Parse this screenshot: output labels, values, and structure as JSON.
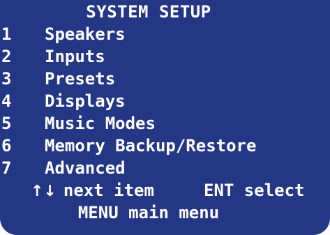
{
  "screen": {
    "title": "SYSTEM SETUP",
    "menu_items": [
      {
        "number": "1",
        "label": "Speakers"
      },
      {
        "number": "2",
        "label": "Inputs"
      },
      {
        "number": "3",
        "label": "Presets"
      },
      {
        "number": "4",
        "label": "Displays"
      },
      {
        "number": "5",
        "label": "Music Modes"
      },
      {
        "number": "6",
        "label": "Memory Backup/Restore"
      },
      {
        "number": "7",
        "label": "Advanced"
      }
    ],
    "footer": {
      "arrows_glyph": "↑↓",
      "next_item_label": "next item",
      "ent_select_label": "ENT select",
      "menu_main_label": "MENU main menu"
    }
  },
  "colors": {
    "background": "#243785",
    "text": "#ffffff",
    "page_background": "#ffffff"
  },
  "icons": {
    "up_down_arrows": "up-down-arrows-icon"
  }
}
